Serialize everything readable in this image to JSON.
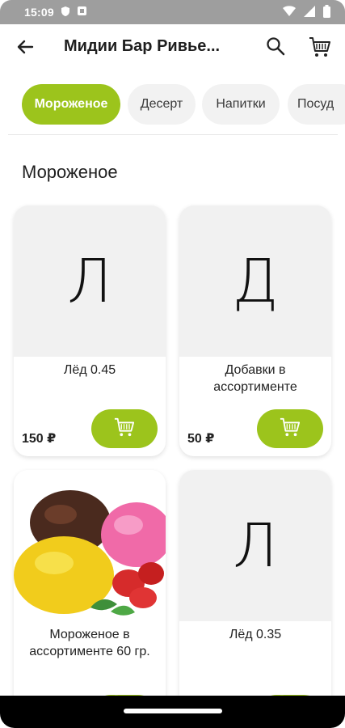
{
  "status_bar": {
    "time": "15:09"
  },
  "header": {
    "title": "Мидии Бар Ривье..."
  },
  "tabs": [
    {
      "label": "Мороженое",
      "active": true
    },
    {
      "label": "Десерт",
      "active": false
    },
    {
      "label": "Напитки",
      "active": false
    },
    {
      "label": "Посуд",
      "active": false
    }
  ],
  "section": {
    "title": "Мороженое"
  },
  "products": [
    {
      "letter": "Л",
      "name": "Лёд 0.45",
      "price": "150 ₽"
    },
    {
      "letter": "Д",
      "name": "Добавки в ассортименте",
      "price": "50 ₽"
    },
    {
      "letter": "",
      "name": "Мороженое в ассортименте 60 гр.",
      "price": ""
    },
    {
      "letter": "Л",
      "name": "Лёд 0.35",
      "price": ""
    }
  ],
  "colors": {
    "accent": "#9cc41c",
    "status_bar": "#9e9e9e",
    "placeholder": "#f1f1f1"
  },
  "icons": {
    "back": "arrow-left-icon",
    "search": "search-icon",
    "cart": "cart-icon",
    "add": "add-to-cart-icon"
  }
}
